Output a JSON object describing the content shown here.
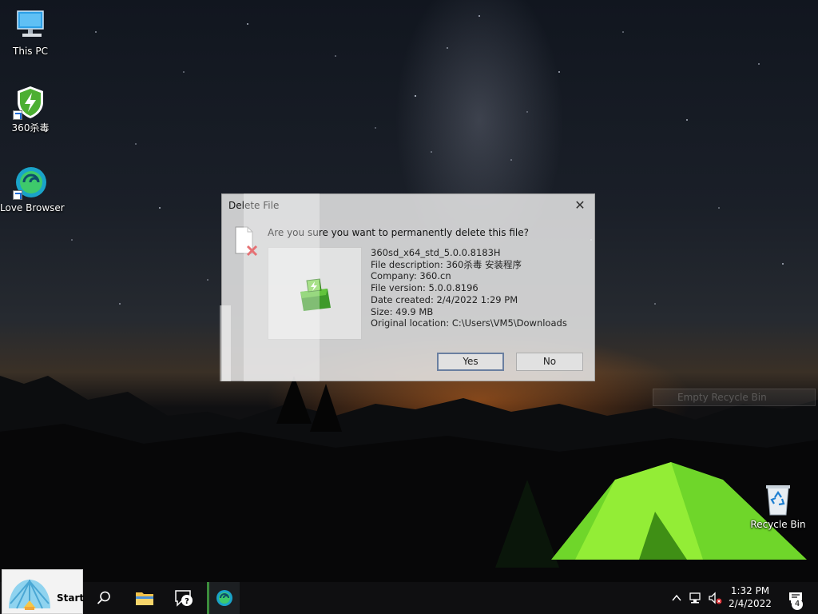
{
  "desktop": {
    "icons": [
      {
        "label": "This PC",
        "icon": "monitor-icon"
      },
      {
        "label": "360杀毒",
        "icon": "shield-lightning-icon"
      },
      {
        "label": "Love Browser",
        "icon": "browser-swirl-icon"
      },
      {
        "label": "Recycle Bin",
        "icon": "recycle-bin-icon"
      }
    ]
  },
  "dialog": {
    "title": "Delete File",
    "close_label": "✕",
    "question": "Are you sure you want to permanently delete this file?",
    "file": {
      "name": "360sd_x64_std_5.0.0.8183H",
      "description": "File description: 360杀毒 安装程序",
      "company": "Company: 360.cn",
      "version": "File version: 5.0.0.8196",
      "date_created": "Date created: 2/4/2022 1:29 PM",
      "size": "Size: 49.9 MB",
      "location": "Original location: C:\\Users\\VM5\\Downloads"
    },
    "yes_label": "Yes",
    "no_label": "No"
  },
  "tooltip": {
    "text": "Empty Recycle Bin"
  },
  "taskbar": {
    "start_label": "Start",
    "icons": [
      "search-icon",
      "file-explorer-icon",
      "help-chat-icon",
      "love-browser-icon"
    ],
    "tray": {
      "time": "1:32 PM",
      "date": "2/4/2022",
      "notification_count": "4"
    }
  },
  "colors": {
    "accent_green": "#3c8d3c",
    "delete_red": "#d9252a",
    "shield_green": "#4caf32"
  }
}
